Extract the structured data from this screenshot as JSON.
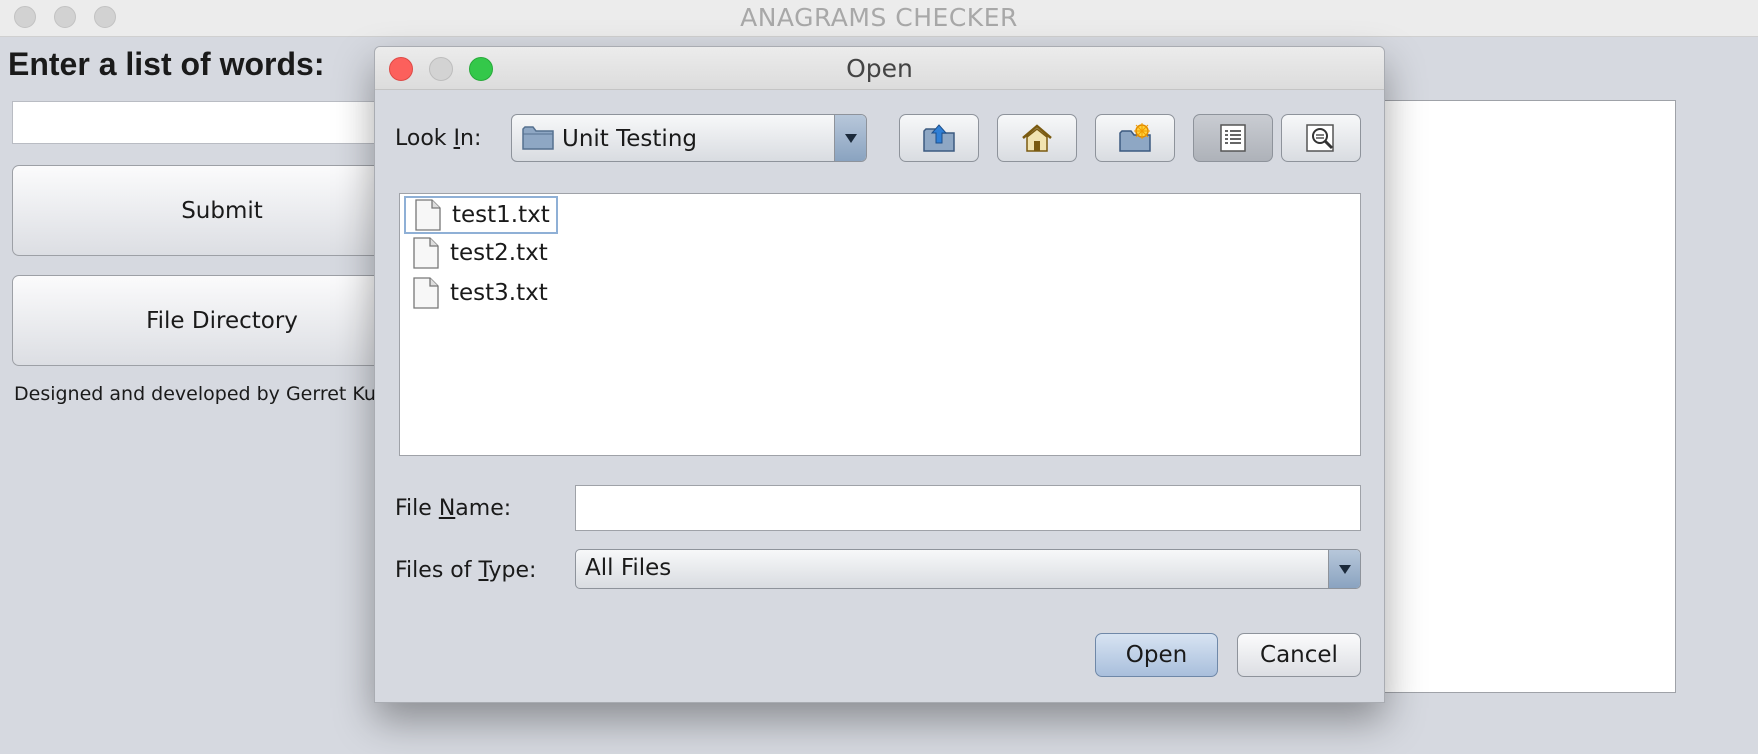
{
  "main_window": {
    "title": "ANAGRAMS CHECKER",
    "words_label": "Enter a list of words:",
    "words_input_value": "",
    "submit_label": "Submit",
    "file_directory_label": "File Directory",
    "credits": "Designed and developed by Gerret Ku",
    "output_text": ""
  },
  "dialog": {
    "title": "Open",
    "look_in": {
      "label_pre": "Look ",
      "label_mnemonic": "I",
      "label_post": "n:",
      "value": "Unit Testing"
    },
    "toolbar": {
      "up_icon": "up-folder-icon",
      "home_icon": "home-icon",
      "new_folder_icon": "new-folder-icon",
      "list_view_icon": "list-view-icon",
      "details_view_icon": "details-view-icon",
      "list_view_active": true
    },
    "files": [
      {
        "name": "test1.txt",
        "selected": true
      },
      {
        "name": "test2.txt",
        "selected": false
      },
      {
        "name": "test3.txt",
        "selected": false
      }
    ],
    "file_name": {
      "label_pre": "File ",
      "label_mnemonic": "N",
      "label_post": "ame:",
      "value": ""
    },
    "files_of_type": {
      "label_pre": "Files of ",
      "label_mnemonic": "T",
      "label_post": "ype:",
      "value": "All Files"
    },
    "open_label": "Open",
    "cancel_label": "Cancel"
  },
  "colors": {
    "close": "#fc605c",
    "minimize": "#d3d3d3",
    "maximize": "#34c84a",
    "background": "#d6d9e0",
    "selection_border": "#8fb0d6"
  }
}
